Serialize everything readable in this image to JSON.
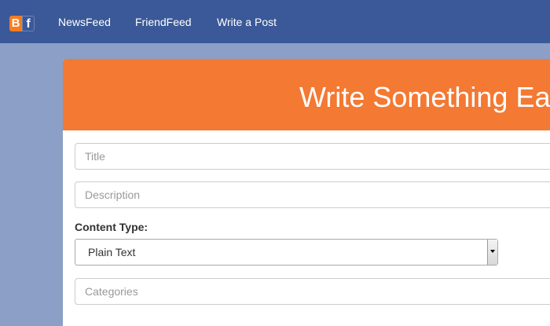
{
  "nav": {
    "logo_b": "B",
    "logo_f": "f",
    "links": [
      "NewsFeed",
      "FriendFeed",
      "Write a Post"
    ]
  },
  "form": {
    "header": "Write Something Ea",
    "title_placeholder": "Title",
    "description_placeholder": "Description",
    "content_type_label": "Content Type:",
    "content_type_value": "Plain Text",
    "categories_placeholder": "Categories"
  },
  "colors": {
    "navbar": "#3b5998",
    "page_background": "#8b9fc7",
    "header_accent": "#f47933",
    "logo_b": "#f57d20"
  },
  "icons": {
    "select_arrow": "chevron-down-icon"
  }
}
